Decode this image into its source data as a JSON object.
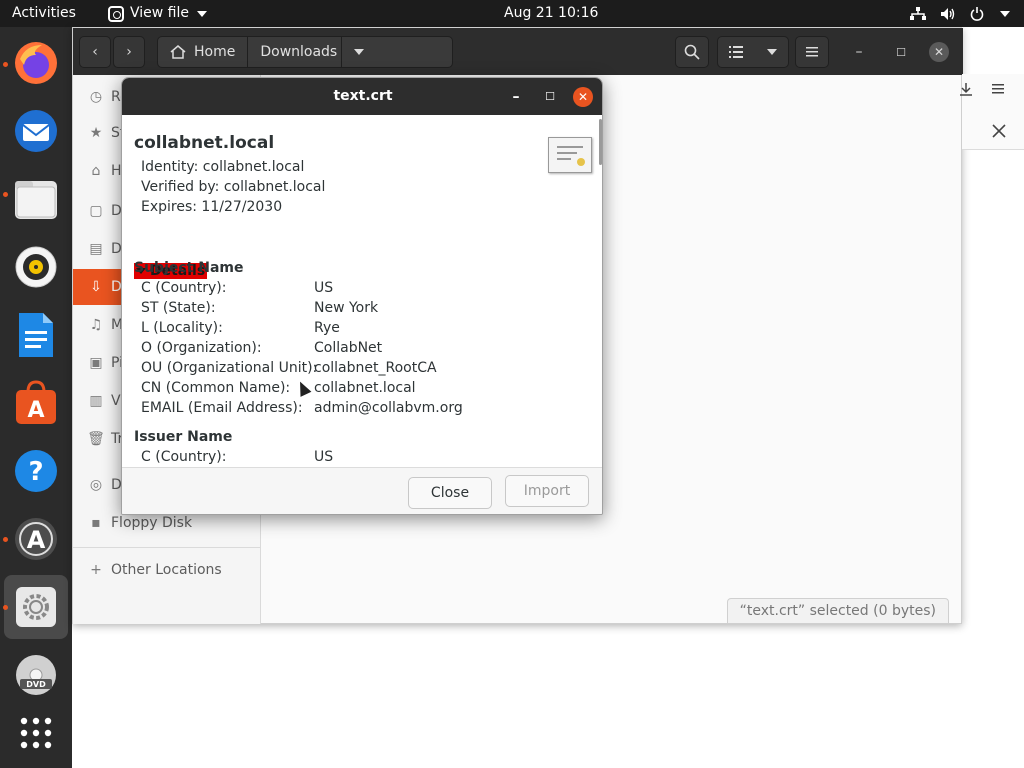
{
  "topbar": {
    "activities": "Activities",
    "app_menu": "View file",
    "clock": "Aug 21  10:16"
  },
  "dock": {
    "apps": [
      "firefox-icon",
      "thunderbird-icon",
      "files-icon",
      "rhythmbox-icon",
      "libreoffice-writer-icon",
      "ubuntu-software-icon",
      "help-icon",
      "software-updater-icon",
      "settings-icon",
      "dvd-icon",
      "show-apps-icon"
    ]
  },
  "files": {
    "path_home": "Home",
    "path_current": "Downloads",
    "sidebar_items": [
      "Re",
      "St",
      "Ho",
      "De",
      "Do",
      "Do",
      "Mu",
      "Pi",
      "Vi",
      "Tr",
      "De",
      "Floppy Disk",
      "Other Locations"
    ],
    "status": "“text.crt” selected  (0 bytes)"
  },
  "dialog": {
    "title": "text.crt",
    "cert_name": "collabnet.local",
    "identity": "Identity: collabnet.local",
    "verified_by": "Verified by: collabnet.local",
    "expires": "Expires: 11/27/2030",
    "details_label": "Details",
    "subject_heading": "Subject Name",
    "subject_rows": [
      {
        "k": "C (Country):",
        "v": "US"
      },
      {
        "k": "ST (State):",
        "v": "New York"
      },
      {
        "k": "L (Locality):",
        "v": "Rye"
      },
      {
        "k": "O (Organization):",
        "v": "CollabNet"
      },
      {
        "k": "OU (Organizational Unit):",
        "v": "collabnet_RootCA"
      },
      {
        "k": "CN (Common Name):",
        "v": "collabnet.local"
      },
      {
        "k": "EMAIL (Email Address):",
        "v": "admin@collabvm.org"
      }
    ],
    "issuer_heading": "Issuer Name",
    "issuer_rows": [
      {
        "k": "C (Country):",
        "v": "US"
      }
    ],
    "close_label": "Close",
    "import_label": "Import"
  },
  "colors": {
    "accent": "#e95420",
    "details_highlight": "#e00000"
  }
}
